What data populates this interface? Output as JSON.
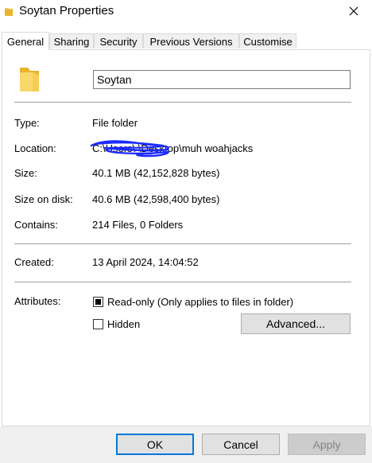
{
  "window": {
    "title": "Soytan Properties",
    "close_icon": "close-icon",
    "folder_icon": "folder-icon"
  },
  "tabs": [
    {
      "label": "General",
      "active": true
    },
    {
      "label": "Sharing",
      "active": false
    },
    {
      "label": "Security",
      "active": false
    },
    {
      "label": "Previous Versions",
      "active": false
    },
    {
      "label": "Customise",
      "active": false
    }
  ],
  "general": {
    "folder_name": "Soytan",
    "type_label": "Type:",
    "type_value": "File folder",
    "location_label": "Location:",
    "location_value": "C:\\Users\\        \\Desktop\\muh woahjacks",
    "size_label": "Size:",
    "size_value": "40.1 MB (42,152,828 bytes)",
    "size_on_disk_label": "Size on disk:",
    "size_on_disk_value": "40.6 MB (42,598,400 bytes)",
    "contains_label": "Contains:",
    "contains_value": "214 Files, 0 Folders",
    "created_label": "Created:",
    "created_value": "13 April 2024, 14:04:52",
    "attributes_label": "Attributes:",
    "readonly_label": "Read-only (Only applies to files in folder)",
    "hidden_label": "Hidden",
    "advanced_label": "Advanced..."
  },
  "buttons": {
    "ok": "OK",
    "cancel": "Cancel",
    "apply": "Apply"
  },
  "colors": {
    "accent": "#0078d7",
    "folder": "#f3c94e",
    "scribble": "#1a2bff"
  }
}
